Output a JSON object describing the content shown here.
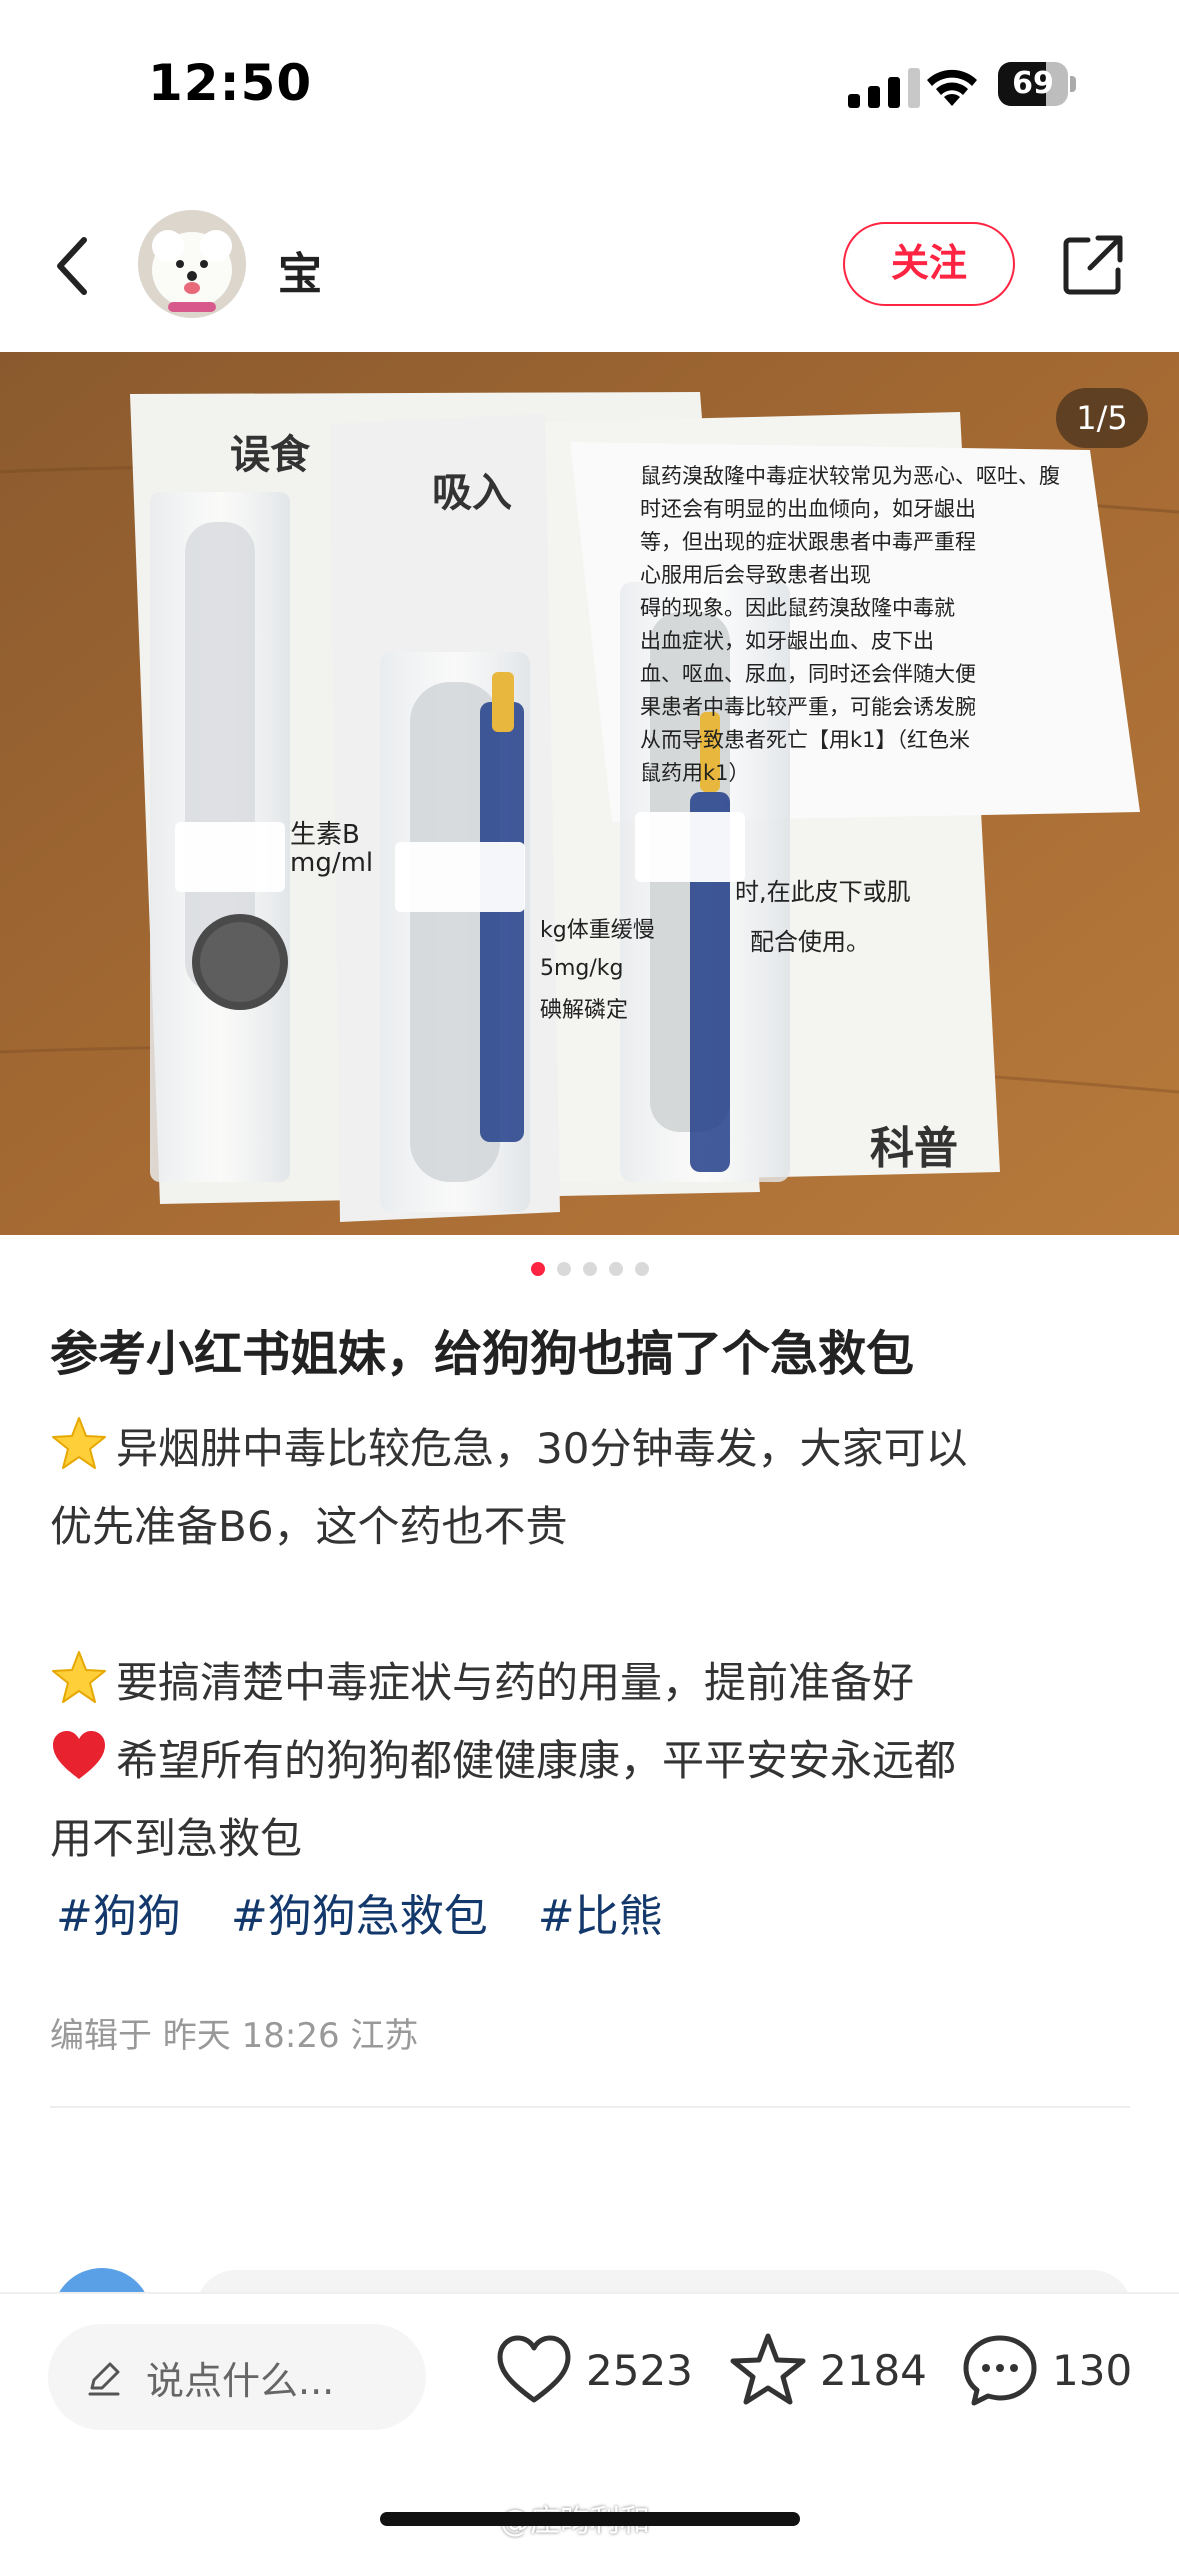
{
  "status_bar": {
    "time": "12:50",
    "battery_level": "69"
  },
  "header": {
    "username": "宝",
    "follow_label": "关注"
  },
  "gallery": {
    "counter": "1/5",
    "total": 5,
    "active_index": 0
  },
  "photo_text": {
    "paper_left_title": "误食",
    "paper_mid_title": "吸入",
    "paper_right_text": "鼠药溴敌隆中毒症状较常见为恶心、呕吐、腹",
    "paper_right_line2": "时还会有明显的出血倾向，如牙龈出",
    "paper_right_line3": "等，但出现的症状跟患者中毒严重程",
    "paper_right_line4": "心服用后会导致患者出现",
    "paper_right_line5": "碍的现象。因此鼠药溴敌隆中毒就",
    "paper_right_line6": "出血症状，如牙龈出血、皮下出",
    "paper_right_line7": "血、呕血、尿血，同时还会伴随大便",
    "paper_right_line8": "果患者中毒比较严重，可能会诱发腕",
    "paper_right_line9": "从而导致患者死亡【用k1】（红色米",
    "paper_right_line10": "鼠药用k1）",
    "paper_left_b": "生素B",
    "paper_left_unit": "mg/ml",
    "paper_mid_dose": "5mg/kg",
    "paper_mid_dose2": "kg体重缓慢",
    "paper_mid_note": "碘解磷定",
    "paper_bottom_text": "配合使用。",
    "paper_right_mid": "时,在此皮下或肌",
    "brand": "科普"
  },
  "post": {
    "title": "参考小红书姐妹，给狗狗也搞了个急救包",
    "line1": "异烟肼中毒比较危急，30分钟毒发，大家可以",
    "line2": "优先准备B6，这个药也不贵",
    "line3": "要搞清楚中毒症状与药的用量，提前准备好",
    "line4": "希望所有的狗狗都健健康康，平平安安永远都",
    "line5": "用不到急救包",
    "tags": [
      "#狗狗",
      "#狗狗急救包",
      "#比熊"
    ],
    "meta": "编辑于 昨天 18:26 江苏"
  },
  "bottom_bar": {
    "comment_placeholder": "说点什么...",
    "likes": "2523",
    "collects": "2184",
    "comments": "130"
  },
  "watermark": "@庄昀利和",
  "colors": {
    "accent": "#ff2442",
    "tag": "#13386c",
    "meta": "#999999"
  }
}
